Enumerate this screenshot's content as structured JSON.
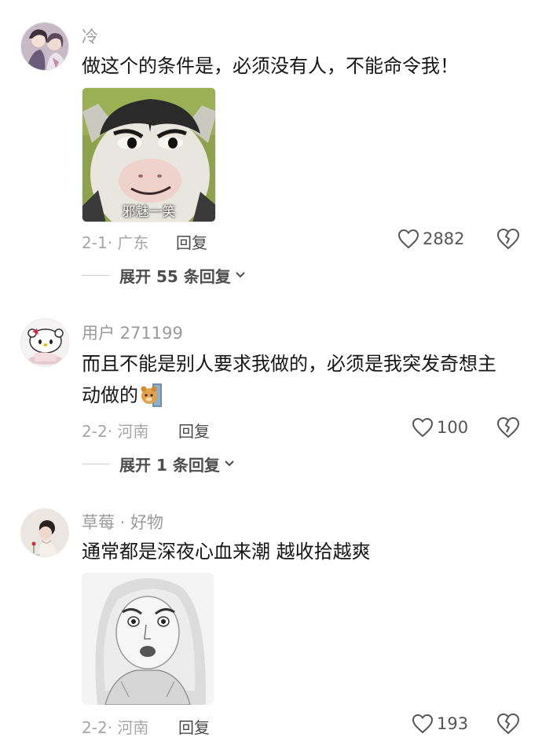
{
  "comments": [
    {
      "username": "冷",
      "text": "做这个的条件是，必须没有人，不能命令我！",
      "sticker_caption": "邪魅一笑",
      "date": "2-1",
      "location": "广东",
      "reply_label": "回复",
      "like_count": "2882",
      "expand_label": "展开 55 条回复"
    },
    {
      "username": "用户 271199",
      "text_line1": "而且不能是别人要求我做的，必须是我突发奇想主",
      "text_line2": "动做的",
      "date": "2-2",
      "location": "河南",
      "reply_label": "回复",
      "like_count": "100",
      "expand_label": "展开 1 条回复"
    },
    {
      "username": "草莓 · 好物",
      "text": "通常都是深夜心血来潮 越收拾越爽",
      "date": "2-2",
      "location": "河南",
      "reply_label": "回复",
      "like_count": "193"
    }
  ],
  "meta_separator": "·",
  "icons": {
    "like": "heart-outline-icon",
    "dislike": "broken-heart-icon",
    "expand": "chevron-down-icon"
  },
  "colors": {
    "text_primary": "#161616",
    "text_secondary": "#9a9a9a",
    "background": "#ffffff"
  }
}
